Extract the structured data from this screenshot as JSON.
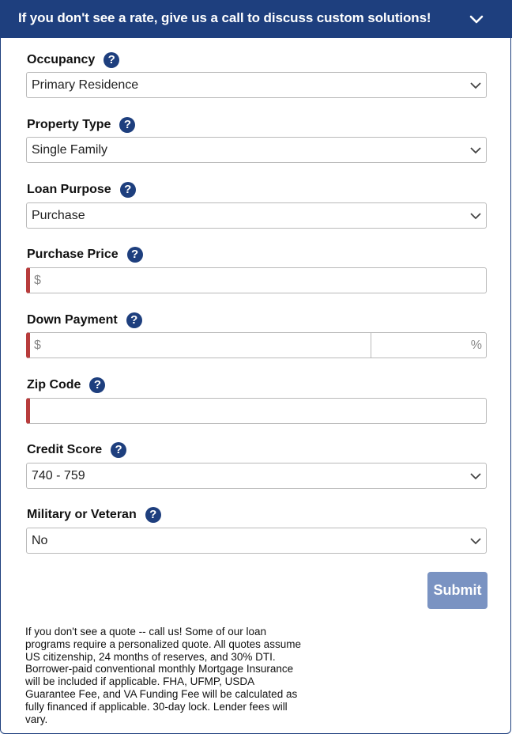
{
  "banner": {
    "text": "If you don't see a rate, give us a call to discuss custom solutions!",
    "icon": "chevron-down-icon"
  },
  "help_glyph": "?",
  "fields": {
    "occupancy": {
      "label": "Occupancy",
      "value": "Primary Residence"
    },
    "property_type": {
      "label": "Property Type",
      "value": "Single Family"
    },
    "loan_purpose": {
      "label": "Loan Purpose",
      "value": "Purchase"
    },
    "purchase_price": {
      "label": "Purchase Price",
      "prefix": "$",
      "value": ""
    },
    "down_payment": {
      "label": "Down Payment",
      "prefix": "$",
      "suffix": "%",
      "value": ""
    },
    "zip_code": {
      "label": "Zip Code",
      "value": ""
    },
    "credit_score": {
      "label": "Credit Score",
      "value": "740 - 759"
    },
    "military": {
      "label": "Military or Veteran",
      "value": "No"
    }
  },
  "submit": {
    "label": "Submit"
  },
  "disclaimer": "If you don't see a quote -- call us! Some of our loan programs require a personalized quote. All quotes assume US citizenship, 24 months of reserves, and 30% DTI. Borrower-paid conventional monthly Mortgage Insurance will be included if applicable. FHA, UFMP, USDA Guarantee Fee, and VA Funding Fee will be calculated as fully financed if applicable. 30-day lock. Lender fees will vary.",
  "colors": {
    "brand": "#1e3f7e",
    "required": "#b83c3c",
    "submit": "#7a93c2"
  }
}
